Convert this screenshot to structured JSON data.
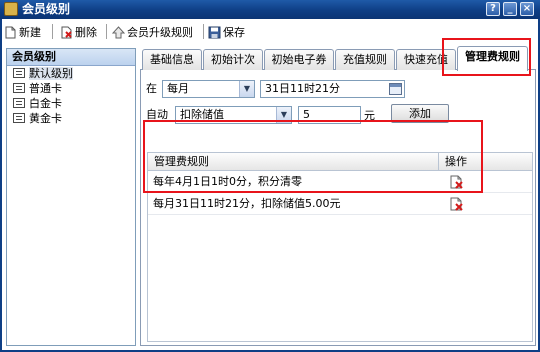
{
  "window": {
    "title": "会员级别",
    "controls": [
      "?",
      "_",
      "×"
    ]
  },
  "toolbar": {
    "new_label": "新建",
    "delete_label": "删除",
    "upgrade_label": "会员升级规则",
    "save_label": "保存"
  },
  "tree": {
    "header": "会员级别",
    "items": [
      {
        "label": "默认级别",
        "selected": true
      },
      {
        "label": "普通卡",
        "selected": false
      },
      {
        "label": "白金卡",
        "selected": false
      },
      {
        "label": "黄金卡",
        "selected": false
      }
    ]
  },
  "tabs": [
    {
      "label": "基础信息",
      "active": false
    },
    {
      "label": "初始计次",
      "active": false
    },
    {
      "label": "初始电子券",
      "active": false
    },
    {
      "label": "充值规则",
      "active": false
    },
    {
      "label": "快速充值",
      "active": false
    },
    {
      "label": "管理费规则",
      "active": true
    }
  ],
  "form": {
    "at_label": "在",
    "period_value": "每月",
    "date_value": "31日11时21分",
    "auto_label": "自动",
    "action_value": "扣除储值",
    "amount_value": "5",
    "unit_label": "元",
    "add_button": "添加"
  },
  "rules_table": {
    "col_rule": "管理费规则",
    "col_action": "操作",
    "rows": [
      {
        "rule": "每年4月1日1时0分，积分清零"
      },
      {
        "rule": "每月31日11时21分，扣除储值5.00元"
      }
    ]
  },
  "colors": {
    "title_bar": "#0e3e85",
    "highlight": "#e8141b",
    "selection": "#dde4ee"
  }
}
